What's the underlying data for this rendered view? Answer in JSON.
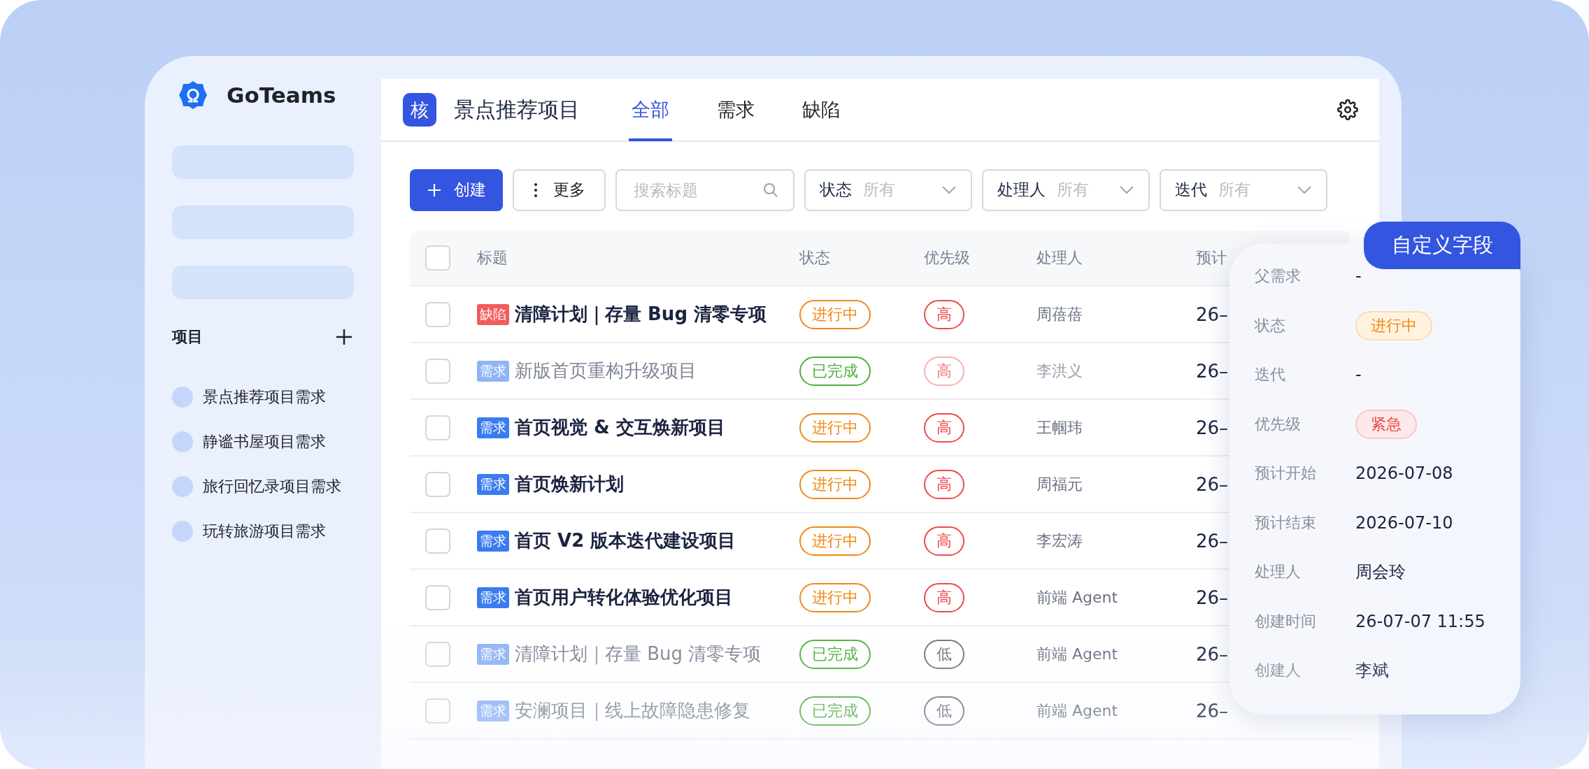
{
  "brand": {
    "name": "GoTeams"
  },
  "sidebar": {
    "section": "项目",
    "projects": [
      "景点推荐项目需求",
      "静谧书屋项目需求",
      "旅行回忆录项目需求",
      "玩转旅游项目需求"
    ]
  },
  "header": {
    "badge": "核",
    "project": "景点推荐项目",
    "tabs": [
      {
        "label": "全部",
        "selected": true
      },
      {
        "label": "需求",
        "selected": false
      },
      {
        "label": "缺陷",
        "selected": false
      }
    ]
  },
  "toolbar": {
    "create": "创建",
    "more": "更多",
    "search": {
      "placeholder": "搜索标题"
    },
    "filters": [
      {
        "label": "状态",
        "value": "所有"
      },
      {
        "label": "处理人",
        "value": "所有"
      },
      {
        "label": "迭代",
        "value": "所有"
      }
    ]
  },
  "table": {
    "all_checked": false,
    "columns": [
      "标题",
      "状态",
      "优先级",
      "处理人",
      "预计"
    ],
    "rows": [
      {
        "checked": false,
        "tag": {
          "label": "缺陷",
          "kind": "defect"
        },
        "title": "清障计划｜存量 Bug 清零专项",
        "muted": false,
        "status": {
          "label": "进行中",
          "kind": "active"
        },
        "priority": {
          "label": "高",
          "kind": "high"
        },
        "assignee": "周蓓蓓",
        "date": "26–"
      },
      {
        "checked": false,
        "tag": {
          "label": "需求",
          "kind": "story"
        },
        "title": "新版首页重构升级项目",
        "muted": true,
        "status": {
          "label": "已完成",
          "kind": "done"
        },
        "priority": {
          "label": "高",
          "kind": "high"
        },
        "assignee": "李洪义",
        "date": "26–"
      },
      {
        "checked": false,
        "tag": {
          "label": "需求",
          "kind": "story"
        },
        "title": "首页视觉 & 交互焕新项目",
        "muted": false,
        "status": {
          "label": "进行中",
          "kind": "active"
        },
        "priority": {
          "label": "高",
          "kind": "high"
        },
        "assignee": "王帼玮",
        "date": "26–"
      },
      {
        "checked": false,
        "tag": {
          "label": "需求",
          "kind": "story"
        },
        "title": "首页焕新计划",
        "muted": false,
        "status": {
          "label": "进行中",
          "kind": "active"
        },
        "priority": {
          "label": "高",
          "kind": "high"
        },
        "assignee": "周福元",
        "date": "26–"
      },
      {
        "checked": false,
        "tag": {
          "label": "需求",
          "kind": "story"
        },
        "title": "首页 V2 版本迭代建设项目",
        "muted": false,
        "status": {
          "label": "进行中",
          "kind": "active"
        },
        "priority": {
          "label": "高",
          "kind": "high"
        },
        "assignee": "李宏涛",
        "date": "26–"
      },
      {
        "checked": false,
        "tag": {
          "label": "需求",
          "kind": "story"
        },
        "title": "首页用户转化体验优化项目",
        "muted": false,
        "status": {
          "label": "进行中",
          "kind": "active"
        },
        "priority": {
          "label": "高",
          "kind": "high"
        },
        "assignee": "前端 Agent",
        "date": "26–"
      },
      {
        "checked": false,
        "tag": {
          "label": "需求",
          "kind": "story"
        },
        "title": "清障计划｜存量 Bug 清零专项",
        "muted": true,
        "status": {
          "label": "已完成",
          "kind": "done"
        },
        "priority": {
          "label": "低",
          "kind": "low"
        },
        "assignee": "前端 Agent",
        "date": "26–"
      },
      {
        "checked": false,
        "tag": {
          "label": "需求",
          "kind": "story"
        },
        "title": "安澜项目｜线上故障隐患修复",
        "muted": true,
        "status": {
          "label": "已完成",
          "kind": "done"
        },
        "priority": {
          "label": "低",
          "kind": "low"
        },
        "assignee": "前端 Agent",
        "date": "26–"
      }
    ]
  },
  "popover": {
    "tab": "自定义字段",
    "fields": [
      {
        "label": "父需求",
        "value": "-",
        "kind": "text"
      },
      {
        "label": "状态",
        "value": "进行中",
        "kind": "warning"
      },
      {
        "label": "迭代",
        "value": "-",
        "kind": "text"
      },
      {
        "label": "优先级",
        "value": "紧急",
        "kind": "danger"
      },
      {
        "label": "预计开始",
        "value": "2026-07-08",
        "kind": "text"
      },
      {
        "label": "预计结束",
        "value": "2026-07-10",
        "kind": "text"
      },
      {
        "label": "处理人",
        "value": "周会玲",
        "kind": "text"
      },
      {
        "label": "创建时间",
        "value": "26-07-07 11:55",
        "kind": "text"
      },
      {
        "label": "创建人",
        "value": "李斌",
        "kind": "text"
      }
    ]
  }
}
